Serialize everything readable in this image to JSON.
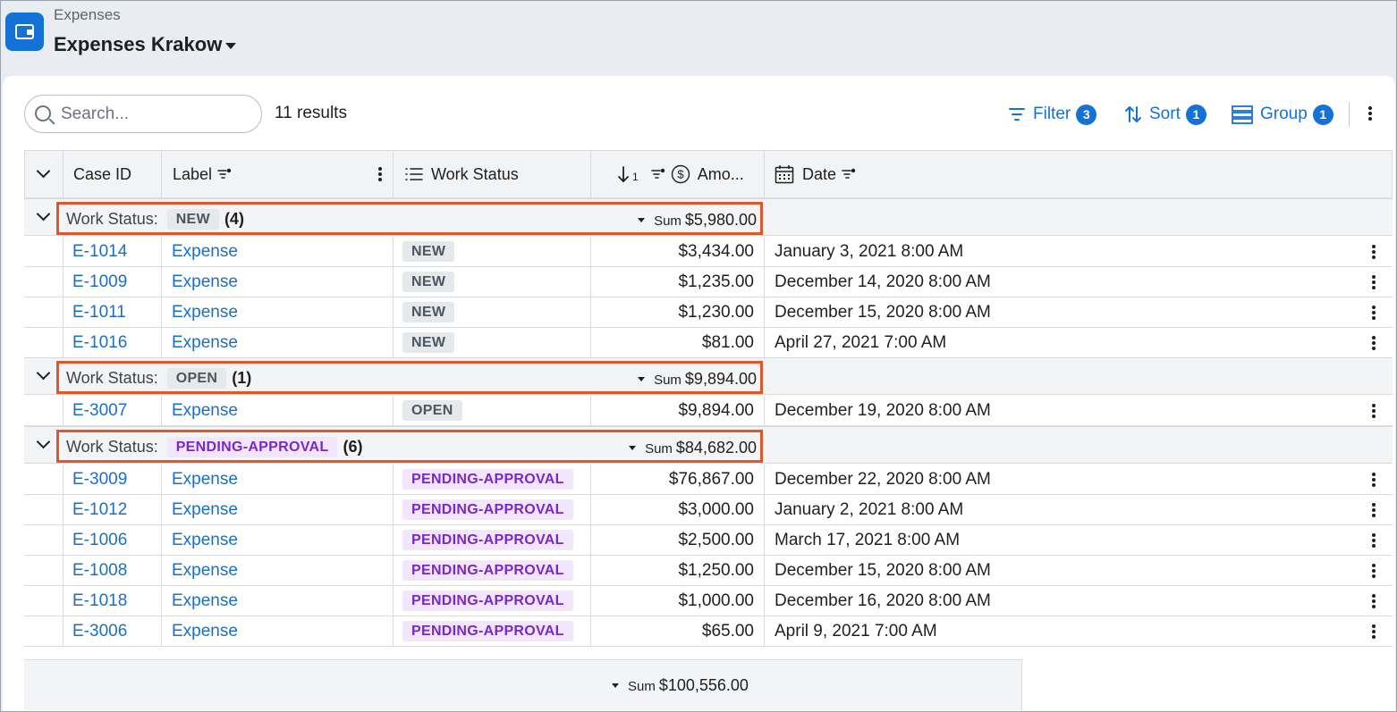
{
  "header": {
    "breadcrumb": "Expenses",
    "title": "Expenses Krakow"
  },
  "toolbar": {
    "search_placeholder": "Search...",
    "results": "11 results",
    "filter_label": "Filter",
    "filter_count": "3",
    "sort_label": "Sort",
    "sort_count": "1",
    "group_label": "Group",
    "group_count": "1"
  },
  "columns": {
    "case_id": "Case ID",
    "label": "Label",
    "work_status": "Work Status",
    "sort_order": "1",
    "amount": "Amo...",
    "date": "Date"
  },
  "group_prefix": "Work Status:",
  "sum_word": "Sum",
  "groups": [
    {
      "status": "NEW",
      "count": "(4)",
      "sum": "$5,980.00",
      "rows": [
        {
          "case_id": "E-1014",
          "label": "Expense",
          "status": "NEW",
          "amount": "$3,434.00",
          "date": "January 3, 2021 8:00 AM"
        },
        {
          "case_id": "E-1009",
          "label": "Expense",
          "status": "NEW",
          "amount": "$1,235.00",
          "date": "December 14, 2020 8:00 AM"
        },
        {
          "case_id": "E-1011",
          "label": "Expense",
          "status": "NEW",
          "amount": "$1,230.00",
          "date": "December 15, 2020 8:00 AM"
        },
        {
          "case_id": "E-1016",
          "label": "Expense",
          "status": "NEW",
          "amount": "$81.00",
          "date": "April 27, 2021 7:00 AM"
        }
      ]
    },
    {
      "status": "OPEN",
      "count": "(1)",
      "sum": "$9,894.00",
      "rows": [
        {
          "case_id": "E-3007",
          "label": "Expense",
          "status": "OPEN",
          "amount": "$9,894.00",
          "date": "December 19, 2020 8:00 AM"
        }
      ]
    },
    {
      "status": "PENDING-APPROVAL",
      "count": "(6)",
      "sum": "$84,682.00",
      "rows": [
        {
          "case_id": "E-3009",
          "label": "Expense",
          "status": "PENDING-APPROVAL",
          "amount": "$76,867.00",
          "date": "December 22, 2020 8:00 AM"
        },
        {
          "case_id": "E-1012",
          "label": "Expense",
          "status": "PENDING-APPROVAL",
          "amount": "$3,000.00",
          "date": "January 2, 2021 8:00 AM"
        },
        {
          "case_id": "E-1006",
          "label": "Expense",
          "status": "PENDING-APPROVAL",
          "amount": "$2,500.00",
          "date": "March 17, 2021 8:00 AM"
        },
        {
          "case_id": "E-1008",
          "label": "Expense",
          "status": "PENDING-APPROVAL",
          "amount": "$1,250.00",
          "date": "December 15, 2020 8:00 AM"
        },
        {
          "case_id": "E-1018",
          "label": "Expense",
          "status": "PENDING-APPROVAL",
          "amount": "$1,000.00",
          "date": "December 16, 2020 8:00 AM"
        },
        {
          "case_id": "E-3006",
          "label": "Expense",
          "status": "PENDING-APPROVAL",
          "amount": "$65.00",
          "date": "April 9, 2021 7:00 AM"
        }
      ]
    }
  ],
  "total_sum": "$100,556.00",
  "colors": {
    "accent": "#1472d6",
    "highlight_border": "#e0552b",
    "pending_text": "#7a28c8",
    "pending_bg": "#f1e6fb"
  }
}
